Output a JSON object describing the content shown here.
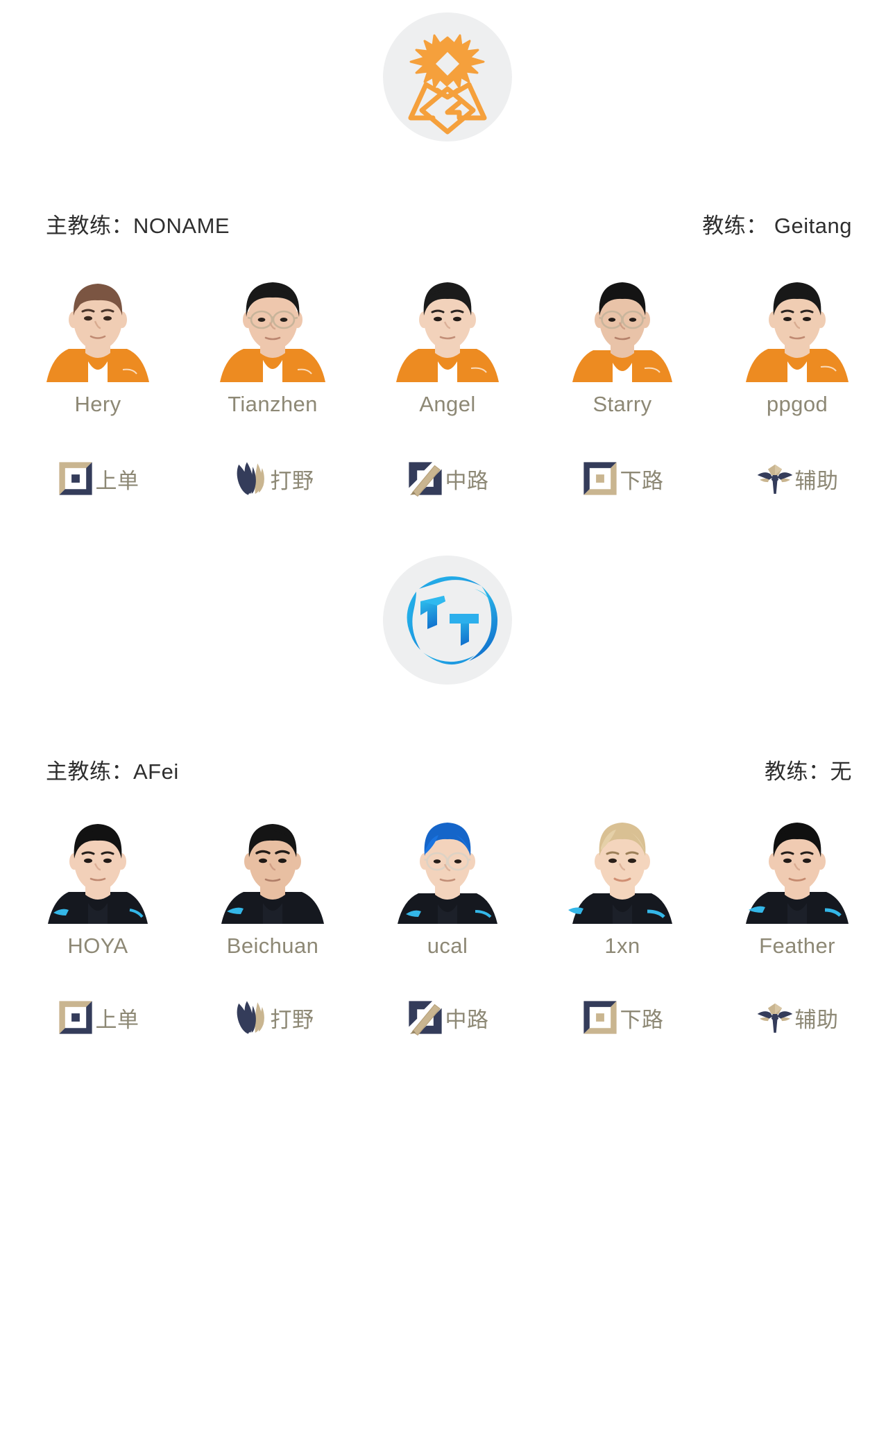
{
  "teams": [
    {
      "id": "lgd",
      "logo_name": "lgd-gaming-logo",
      "logo_accent": "#F5A03C",
      "logo_bg": "#EEEFF0",
      "head_coach_label": "主教练：",
      "head_coach_name": "NONAME",
      "coach_label": "教练：",
      "coach_name": "Geitang",
      "jersey_color": "#ED8B21",
      "players": [
        {
          "name": "Hery",
          "hair": "#7b5542",
          "skin": "#f0cdb4",
          "glasses": false
        },
        {
          "name": "Tianzhen",
          "hair": "#191919",
          "skin": "#eec7ad",
          "glasses": true
        },
        {
          "name": "Angel",
          "hair": "#1b1b1b",
          "skin": "#f2d2bb",
          "glasses": false
        },
        {
          "name": "Starry",
          "hair": "#141414",
          "skin": "#e9c3a8",
          "glasses": true
        },
        {
          "name": "ppgod",
          "hair": "#181818",
          "skin": "#f0cdb3",
          "glasses": false
        }
      ],
      "roles": [
        {
          "label": "上单",
          "icon": "top-lane-icon"
        },
        {
          "label": "打野",
          "icon": "jungle-icon"
        },
        {
          "label": "中路",
          "icon": "mid-lane-icon"
        },
        {
          "label": "下路",
          "icon": "bot-lane-icon"
        },
        {
          "label": "辅助",
          "icon": "support-icon"
        }
      ]
    },
    {
      "id": "tt",
      "logo_name": "thunder-talk-logo",
      "logo_accent": "#1E9FE0",
      "logo_bg": "#EEEFF0",
      "head_coach_label": "主教练：",
      "head_coach_name": "AFei",
      "coach_label": "教练：",
      "coach_name": "无",
      "jersey_color": "#15181F",
      "players": [
        {
          "name": "HOYA",
          "hair": "#121212",
          "skin": "#f2d0b9",
          "glasses": false
        },
        {
          "name": "Beichuan",
          "hair": "#151515",
          "skin": "#e8bfa2",
          "glasses": false
        },
        {
          "name": "ucal",
          "hair": "#1565c9",
          "skin": "#f3d3bc",
          "glasses": true
        },
        {
          "name": "1xn",
          "hair": "#d9c093",
          "skin": "#f4d5bd",
          "glasses": false
        },
        {
          "name": "Feather",
          "hair": "#101010",
          "skin": "#f0cbb2",
          "glasses": false
        }
      ],
      "roles": [
        {
          "label": "上单",
          "icon": "top-lane-icon"
        },
        {
          "label": "打野",
          "icon": "jungle-icon"
        },
        {
          "label": "中路",
          "icon": "mid-lane-icon"
        },
        {
          "label": "下路",
          "icon": "bot-lane-icon"
        },
        {
          "label": "辅助",
          "icon": "support-icon"
        }
      ]
    }
  ],
  "palette": {
    "role_navy": "#343C5A",
    "role_tan": "#C9B590",
    "name_text": "#8D8875",
    "staff_text": "#2E2E2E",
    "background": "#FFFFFF"
  }
}
